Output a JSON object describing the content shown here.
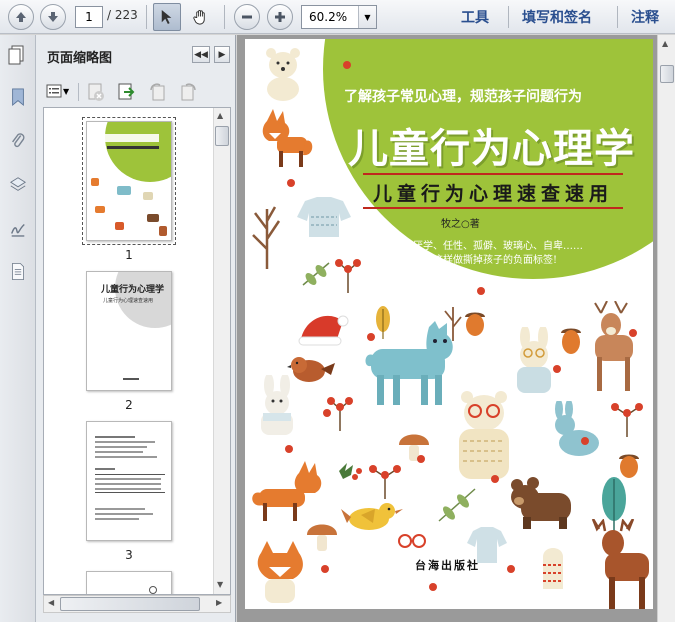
{
  "toolbar": {
    "page_current": "1",
    "page_total": "/ 223",
    "zoom": "60.2%",
    "menu": [
      "工具",
      "填写和签名",
      "注释"
    ]
  },
  "panel": {
    "title": "页面缩略图",
    "thumbnails": [
      {
        "number": "1"
      },
      {
        "number": "2"
      },
      {
        "number": "3"
      }
    ]
  },
  "cover": {
    "subtitle": "了解孩子常见心理，规范孩子问题行为",
    "title": "儿童行为心理学",
    "band": "儿童行为心理速查速用",
    "author": "牧之○著",
    "tagline_1": "厌学、任性、孤僻、玻璃心、自卑……",
    "tagline_2": "这样做撕掉孩子的负面标签!",
    "publisher": "台海出版社"
  },
  "thumb2": {
    "title": "儿童行为心理学",
    "band": "儿童行为心理速查速用"
  },
  "colors": {
    "accent_green": "#9ec33a",
    "menu_text": "#2a4f8f",
    "band_red": "#c0281e"
  }
}
